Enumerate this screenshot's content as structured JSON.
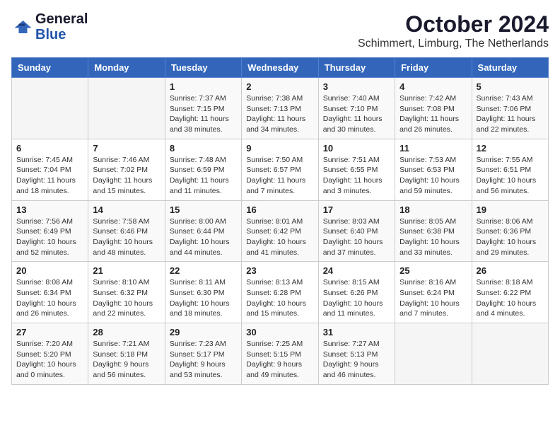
{
  "header": {
    "logo_general": "General",
    "logo_blue": "Blue",
    "month": "October 2024",
    "location": "Schimmert, Limburg, The Netherlands"
  },
  "weekdays": [
    "Sunday",
    "Monday",
    "Tuesday",
    "Wednesday",
    "Thursday",
    "Friday",
    "Saturday"
  ],
  "weeks": [
    [
      {
        "day": "",
        "detail": ""
      },
      {
        "day": "",
        "detail": ""
      },
      {
        "day": "1",
        "detail": "Sunrise: 7:37 AM\nSunset: 7:15 PM\nDaylight: 11 hours and 38 minutes."
      },
      {
        "day": "2",
        "detail": "Sunrise: 7:38 AM\nSunset: 7:13 PM\nDaylight: 11 hours and 34 minutes."
      },
      {
        "day": "3",
        "detail": "Sunrise: 7:40 AM\nSunset: 7:10 PM\nDaylight: 11 hours and 30 minutes."
      },
      {
        "day": "4",
        "detail": "Sunrise: 7:42 AM\nSunset: 7:08 PM\nDaylight: 11 hours and 26 minutes."
      },
      {
        "day": "5",
        "detail": "Sunrise: 7:43 AM\nSunset: 7:06 PM\nDaylight: 11 hours and 22 minutes."
      }
    ],
    [
      {
        "day": "6",
        "detail": "Sunrise: 7:45 AM\nSunset: 7:04 PM\nDaylight: 11 hours and 18 minutes."
      },
      {
        "day": "7",
        "detail": "Sunrise: 7:46 AM\nSunset: 7:02 PM\nDaylight: 11 hours and 15 minutes."
      },
      {
        "day": "8",
        "detail": "Sunrise: 7:48 AM\nSunset: 6:59 PM\nDaylight: 11 hours and 11 minutes."
      },
      {
        "day": "9",
        "detail": "Sunrise: 7:50 AM\nSunset: 6:57 PM\nDaylight: 11 hours and 7 minutes."
      },
      {
        "day": "10",
        "detail": "Sunrise: 7:51 AM\nSunset: 6:55 PM\nDaylight: 11 hours and 3 minutes."
      },
      {
        "day": "11",
        "detail": "Sunrise: 7:53 AM\nSunset: 6:53 PM\nDaylight: 10 hours and 59 minutes."
      },
      {
        "day": "12",
        "detail": "Sunrise: 7:55 AM\nSunset: 6:51 PM\nDaylight: 10 hours and 56 minutes."
      }
    ],
    [
      {
        "day": "13",
        "detail": "Sunrise: 7:56 AM\nSunset: 6:49 PM\nDaylight: 10 hours and 52 minutes."
      },
      {
        "day": "14",
        "detail": "Sunrise: 7:58 AM\nSunset: 6:46 PM\nDaylight: 10 hours and 48 minutes."
      },
      {
        "day": "15",
        "detail": "Sunrise: 8:00 AM\nSunset: 6:44 PM\nDaylight: 10 hours and 44 minutes."
      },
      {
        "day": "16",
        "detail": "Sunrise: 8:01 AM\nSunset: 6:42 PM\nDaylight: 10 hours and 41 minutes."
      },
      {
        "day": "17",
        "detail": "Sunrise: 8:03 AM\nSunset: 6:40 PM\nDaylight: 10 hours and 37 minutes."
      },
      {
        "day": "18",
        "detail": "Sunrise: 8:05 AM\nSunset: 6:38 PM\nDaylight: 10 hours and 33 minutes."
      },
      {
        "day": "19",
        "detail": "Sunrise: 8:06 AM\nSunset: 6:36 PM\nDaylight: 10 hours and 29 minutes."
      }
    ],
    [
      {
        "day": "20",
        "detail": "Sunrise: 8:08 AM\nSunset: 6:34 PM\nDaylight: 10 hours and 26 minutes."
      },
      {
        "day": "21",
        "detail": "Sunrise: 8:10 AM\nSunset: 6:32 PM\nDaylight: 10 hours and 22 minutes."
      },
      {
        "day": "22",
        "detail": "Sunrise: 8:11 AM\nSunset: 6:30 PM\nDaylight: 10 hours and 18 minutes."
      },
      {
        "day": "23",
        "detail": "Sunrise: 8:13 AM\nSunset: 6:28 PM\nDaylight: 10 hours and 15 minutes."
      },
      {
        "day": "24",
        "detail": "Sunrise: 8:15 AM\nSunset: 6:26 PM\nDaylight: 10 hours and 11 minutes."
      },
      {
        "day": "25",
        "detail": "Sunrise: 8:16 AM\nSunset: 6:24 PM\nDaylight: 10 hours and 7 minutes."
      },
      {
        "day": "26",
        "detail": "Sunrise: 8:18 AM\nSunset: 6:22 PM\nDaylight: 10 hours and 4 minutes."
      }
    ],
    [
      {
        "day": "27",
        "detail": "Sunrise: 7:20 AM\nSunset: 5:20 PM\nDaylight: 10 hours and 0 minutes."
      },
      {
        "day": "28",
        "detail": "Sunrise: 7:21 AM\nSunset: 5:18 PM\nDaylight: 9 hours and 56 minutes."
      },
      {
        "day": "29",
        "detail": "Sunrise: 7:23 AM\nSunset: 5:17 PM\nDaylight: 9 hours and 53 minutes."
      },
      {
        "day": "30",
        "detail": "Sunrise: 7:25 AM\nSunset: 5:15 PM\nDaylight: 9 hours and 49 minutes."
      },
      {
        "day": "31",
        "detail": "Sunrise: 7:27 AM\nSunset: 5:13 PM\nDaylight: 9 hours and 46 minutes."
      },
      {
        "day": "",
        "detail": ""
      },
      {
        "day": "",
        "detail": ""
      }
    ]
  ]
}
